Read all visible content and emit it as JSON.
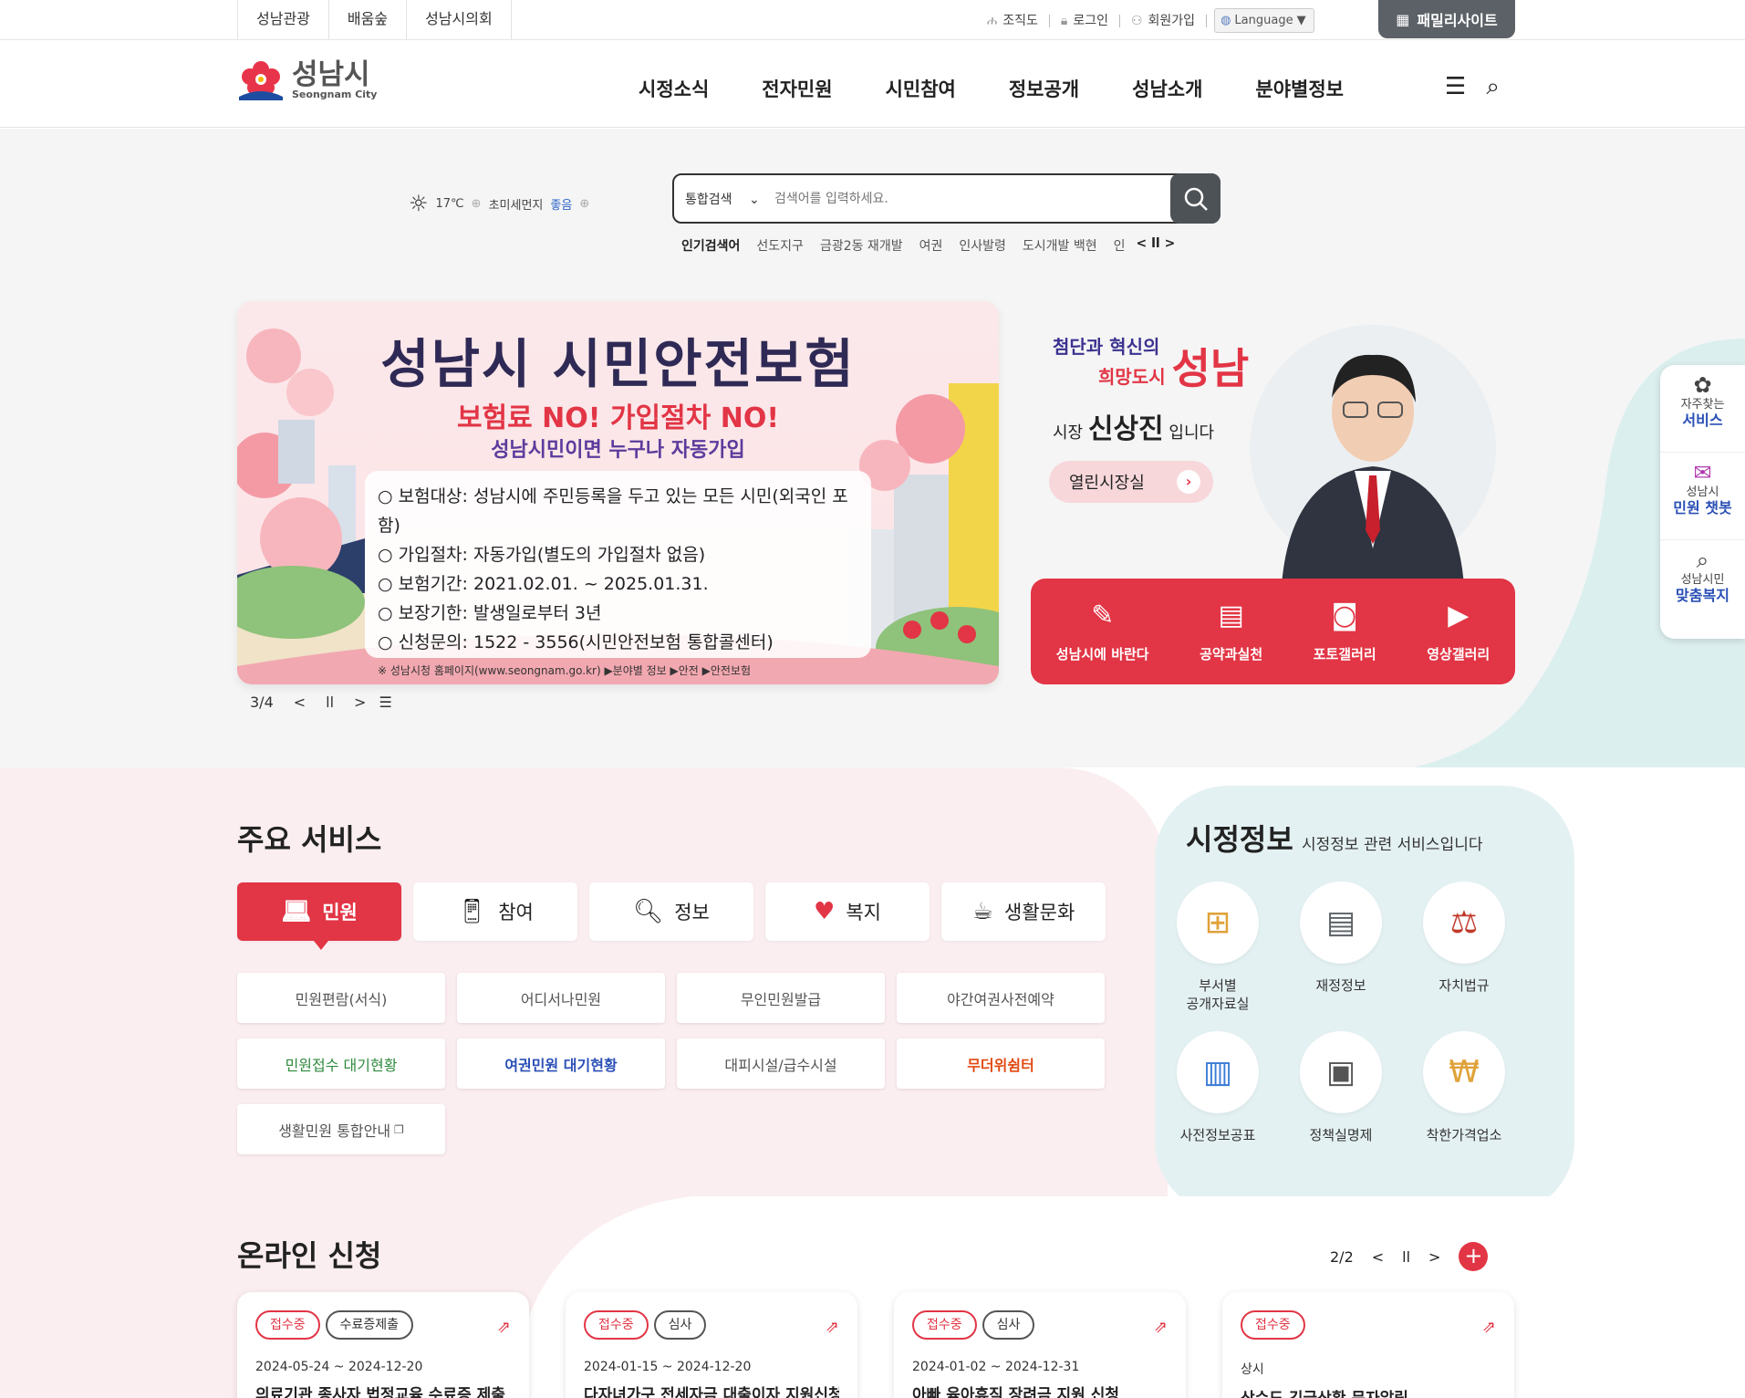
{
  "top_links": [
    "성남관광",
    "배움숲",
    "성남시의회"
  ],
  "util": {
    "org": "조직도",
    "login": "로그인",
    "join": "회원가입",
    "language": "Language"
  },
  "family_site": "패밀리사이트",
  "logo": {
    "kr": "성남시",
    "en": "Seongnam City"
  },
  "gnb": [
    "시정소식",
    "전자민원",
    "시민참여",
    "정보공개",
    "성남소개",
    "분야별정보"
  ],
  "weather": {
    "temp": "17℃",
    "dust_label": "초미세먼지",
    "dust_value": "좋음"
  },
  "search": {
    "scope": "통합검색",
    "placeholder": "검색어를 입력하세요."
  },
  "popular": {
    "label": "인기검색어",
    "items": [
      "선도지구",
      "금광2동 재개발",
      "여권",
      "인사발령",
      "도시개발 백현",
      "인"
    ]
  },
  "banner": {
    "title": "성남시 시민안전보험",
    "sub1": "보험료 NO!  가입절차 NO!",
    "sub2": "성남시민이면 누구나 자동가입",
    "lines": [
      "○ 보험대상: 성남시에 주민등록을 두고 있는 모든 시민(외국인 포함)",
      "○ 가입절차: 자동가입(별도의 가입절차 없음)",
      "○ 보험기간: 2021.02.01. ~ 2025.01.31.",
      "○ 보장기한: 발생일로부터 3년",
      "○ 신청문의: 1522 - 3556(시민안전보험 통합콜센터)"
    ],
    "note": "※ 성남시청 홈페이지(www.seongnam.go.kr) ▶분야별 정보 ▶안전 ▶안전보험",
    "counter": "3/4"
  },
  "mayor": {
    "slogan_line1": "첨단과 혁신의",
    "slogan_line2": "희망도시",
    "slogan_big": "성남",
    "title_prefix": "시장",
    "name": "신상진",
    "title_suffix": "입니다",
    "open_office": "열린시장실",
    "menu": [
      "성남시에 바란다",
      "공약과실천",
      "포토갤러리",
      "영상갤러리"
    ]
  },
  "quick": [
    {
      "small": "자주찾는",
      "big": "서비스"
    },
    {
      "small": "성남시",
      "big": "민원 챗봇"
    },
    {
      "small": "성남시민",
      "big": "맞춤복지"
    }
  ],
  "main_service": {
    "title": "주요 서비스",
    "tabs": [
      "민원",
      "참여",
      "정보",
      "복지",
      "생활문화"
    ],
    "items": [
      "민원편람(서식)",
      "어디서나민원",
      "무인민원발급",
      "야간여권사전예약",
      "민원접수 대기현황",
      "여권민원 대기현황",
      "대피시설/급수시설",
      "무더위쉼터",
      "생활민원 통합안내"
    ]
  },
  "city_info": {
    "title": "시정정보",
    "subtitle": "시정정보 관련 서비스입니다",
    "items": [
      "부서별\n공개자료실",
      "재정정보",
      "자치법규",
      "사전정보공표",
      "정책실명제",
      "착한가격업소"
    ]
  },
  "online": {
    "title": "온라인 신청",
    "counter": "2/2",
    "cards": [
      {
        "badges": [
          "접수중",
          "수료증제출"
        ],
        "date": "2024-05-24 ~ 2024-12-20",
        "title": "의료기관 종사자 법정교육 수료증 제출"
      },
      {
        "badges": [
          "접수중",
          "심사"
        ],
        "date": "2024-01-15 ~ 2024-12-20",
        "title": "다자녀가구 전세자금 대출이자 지원신청"
      },
      {
        "badges": [
          "접수중",
          "심사"
        ],
        "date": "2024-01-02 ~ 2024-12-31",
        "title": "아빠 육아휴직 장려금 지원 신청"
      },
      {
        "badges": [
          "접수중"
        ],
        "date": "상시",
        "title": "상수도 긴급상황 문자알림"
      }
    ]
  },
  "colors": {
    "accent": "#e23545",
    "navy": "#3b3290",
    "gray_button": "#5b6167"
  }
}
